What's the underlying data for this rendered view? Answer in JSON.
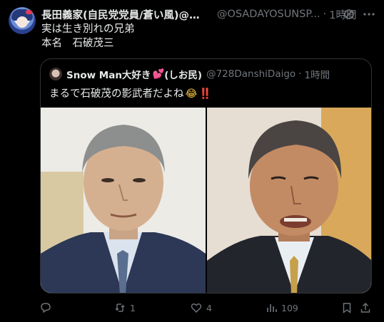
{
  "post": {
    "author_name": "長田義家(自民党党員/蒼い風)@寛容...",
    "author_handle": "@OSADAYOSUNSP...",
    "separator": "·",
    "time": "1時間",
    "text_line1": "実は生き別れの兄弟",
    "text_line2": "本名　石破茂三"
  },
  "quote": {
    "author_name": "Snow Man大好き",
    "heart_emoji": "💕",
    "author_name_suffix": "(しお民)",
    "author_handle": "@728DanshiDaigo",
    "separator": "·",
    "time": "1時間",
    "text": "まるで石破茂の影武者だよね",
    "laugh_emoji": "😂",
    "exclaim_emoji": "‼️"
  },
  "actions": {
    "reply_count": "",
    "retweet_count": "1",
    "like_count": "4",
    "view_count": "109"
  },
  "icons": {
    "avatar": "avatar-anime-icon",
    "grok": "grok-icon",
    "more": "more-dots-icon",
    "reply": "reply-icon",
    "retweet": "retweet-icon",
    "like": "heart-icon",
    "views": "views-chart-icon",
    "bookmark": "bookmark-icon",
    "share": "share-icon"
  },
  "colors": {
    "background": "#000000",
    "text": "#e7e9ea",
    "muted": "#71767b",
    "border": "#2f3336"
  }
}
